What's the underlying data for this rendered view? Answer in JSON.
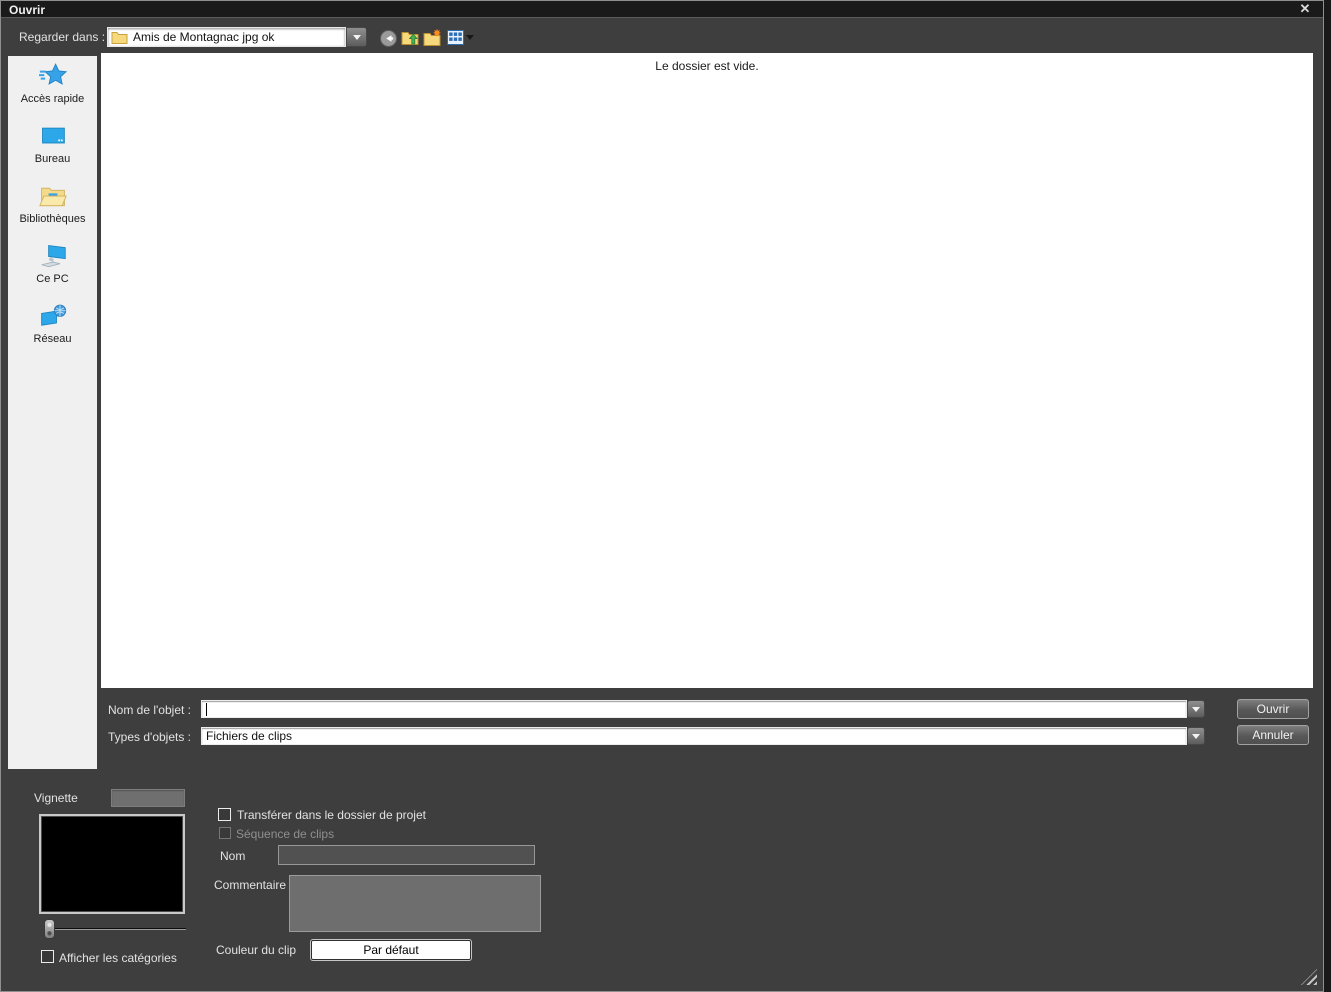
{
  "colors": {
    "dialog_bg": "#3e3e3e",
    "titlebar_bg": "#1a1a1a",
    "sidebar_bg": "#f0f0f0",
    "filelist_bg": "#ffffff",
    "button_gray": "#5c5c5c",
    "folder_yellow": "#f5d97c",
    "icon_blue": "#2ba7ea",
    "preview_black": "#000000"
  },
  "window": {
    "title": "Ouvrir",
    "close_label": "✕"
  },
  "toolbar": {
    "look_in": {
      "label": "Regarder dans :",
      "value": "Amis de Montagnac jpg ok",
      "icon": "folder-icon"
    },
    "icons": [
      "back-icon",
      "parent-folder-icon",
      "new-folder-icon",
      "view-menu-icon"
    ]
  },
  "sidebar": {
    "items": [
      {
        "icon": "quick-access-icon",
        "label": "Accès rapide"
      },
      {
        "icon": "desktop-icon",
        "label": "Bureau"
      },
      {
        "icon": "libraries-icon",
        "label": "Bibliothèques"
      },
      {
        "icon": "this-pc-icon",
        "label": "Ce PC"
      },
      {
        "icon": "network-icon",
        "label": "Réseau"
      }
    ]
  },
  "filelist": {
    "empty_message": "Le dossier est vide."
  },
  "file_name": {
    "label": "Nom de l'objet :",
    "value": ""
  },
  "file_type": {
    "label": "Types d'objets :",
    "value": "Fichiers de clips"
  },
  "actions": {
    "open": "Ouvrir",
    "cancel": "Annuler"
  },
  "options": {
    "thumbnail_label": "Vignette",
    "show_categories": {
      "label": "Afficher les catégories",
      "checked": false
    },
    "transfer": {
      "label": "Transférer dans le dossier de projet",
      "checked": false
    },
    "clip_sequence": {
      "label": "Séquence de clips",
      "checked": false,
      "disabled": true
    },
    "name": {
      "label": "Nom",
      "value": ""
    },
    "comment": {
      "label": "Commentaire",
      "value": ""
    },
    "clip_color": {
      "label": "Couleur du clip",
      "button_label": "Par défaut"
    }
  }
}
